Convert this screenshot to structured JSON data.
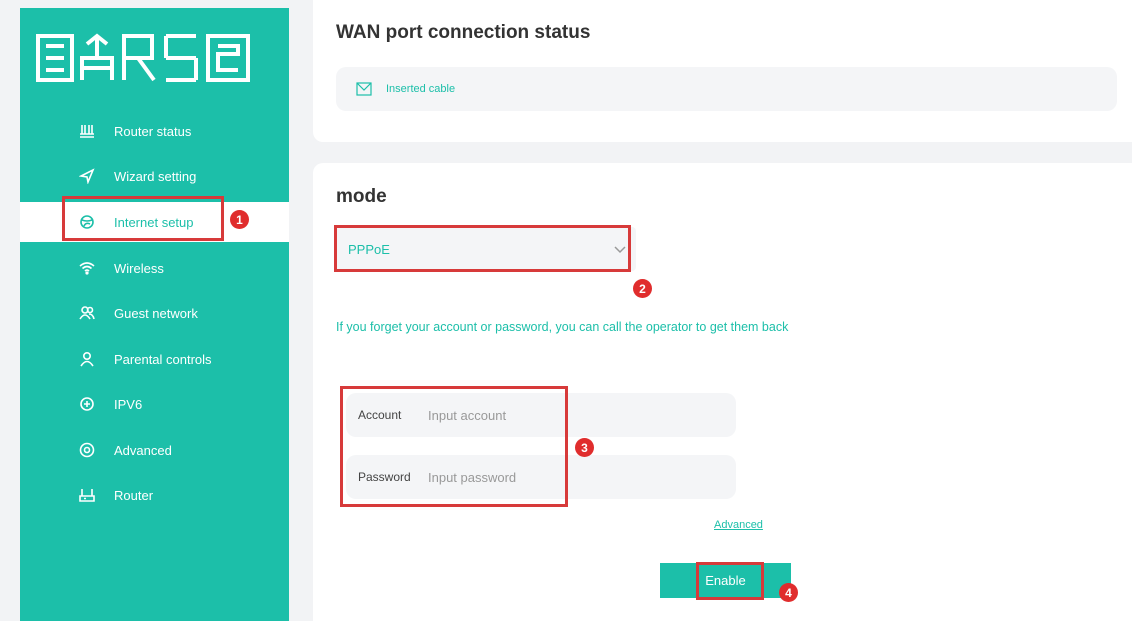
{
  "sidebar": {
    "logo": "logo",
    "items": [
      {
        "label": "Router status",
        "icon": "router-status-icon"
      },
      {
        "label": "Wizard setting",
        "icon": "navigation-arrow-icon"
      },
      {
        "label": "Internet setup",
        "icon": "internet-globe-icon",
        "active": true
      },
      {
        "label": "Wireless",
        "icon": "wifi-icon"
      },
      {
        "label": "Guest network",
        "icon": "guest-users-icon"
      },
      {
        "label": "Parental controls",
        "icon": "parent-user-icon"
      },
      {
        "label": "IPV6",
        "icon": "ipv6-icon"
      },
      {
        "label": "Advanced",
        "icon": "advanced-settings-icon"
      },
      {
        "label": "Router",
        "icon": "router-icon"
      }
    ]
  },
  "wan": {
    "title": "WAN port connection status",
    "status_icon": "cable-icon",
    "status_text": "Inserted cable"
  },
  "mode": {
    "title": "mode",
    "selected": "PPPoE",
    "hint": "If you forget your account or password, you can call the operator to get them back",
    "account_label": "Account",
    "account_placeholder": "Input account",
    "password_label": "Password",
    "password_placeholder": "Input password",
    "advanced_link": "Advanced",
    "enable_button": "Enable"
  },
  "annotations": [
    "1",
    "2",
    "3",
    "4"
  ],
  "colors": {
    "accent": "#1cbfa9",
    "annotation": "#d73a3a",
    "background": "#f2f3f5"
  }
}
